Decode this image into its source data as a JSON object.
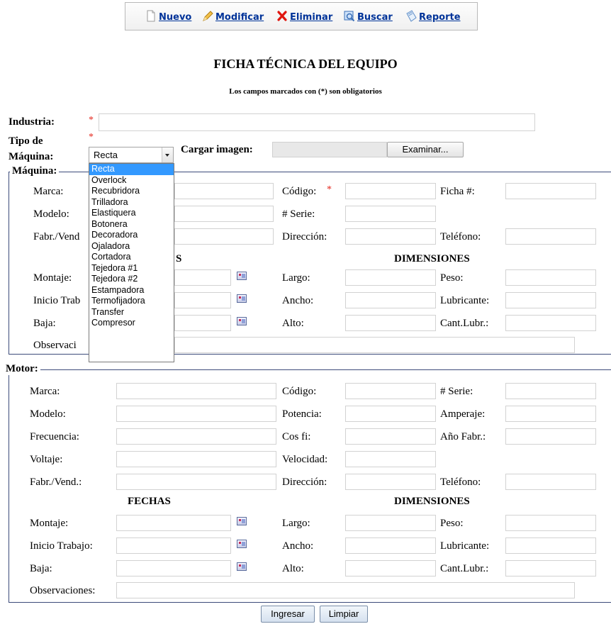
{
  "toolbar": {
    "items": [
      {
        "label": "Nuevo",
        "icon": "new-page-icon"
      },
      {
        "label": "Modificar",
        "icon": "pencil-icon"
      },
      {
        "label": "Eliminar",
        "icon": "delete-x-icon"
      },
      {
        "label": "Buscar",
        "icon": "search-icon"
      },
      {
        "label": "Reporte",
        "icon": "report-icon"
      }
    ]
  },
  "page": {
    "title": "FICHA TÉCNICA DEL EQUIPO",
    "subtitle": "Los campos marcados con (*) son obligatorios"
  },
  "header": {
    "industria_label": "Industria:",
    "tipo_label_1": "Tipo de",
    "tipo_label_2": "Máquina:",
    "required_mark": "*",
    "tipo_selected": "Recta",
    "cargar_label": "Cargar imagen:",
    "examinar_label": "Examinar..."
  },
  "dropdown": {
    "options": [
      "Recta",
      "Overlock",
      "Recubridora",
      "Trilladora",
      "Elastiquera",
      "Botonera",
      "Decoradora",
      "Ojaladora",
      "Cortadora",
      "Tejedora #1",
      "Tejedora #2",
      "Estampadora",
      "Termofijadora",
      "Transfer",
      "Compresor"
    ]
  },
  "maquina": {
    "legend": "Máquina:",
    "marca": "Marca:",
    "codigo": "Código:",
    "ficha": "Ficha #:",
    "modelo": "Modelo:",
    "serie": "# Serie:",
    "fabr": "Fabr./Vend",
    "direccion": "Dirección:",
    "telefono": "Teléfono:",
    "fechas_tail": "S",
    "dimensiones": "DIMENSIONES",
    "montaje": "Montaje:",
    "largo": "Largo:",
    "peso": "Peso:",
    "inicio": "Inicio Trab",
    "ancho": "Ancho:",
    "lubricante": "Lubricante:",
    "baja": "Baja:",
    "alto": "Alto:",
    "cant": "Cant.Lubr.:",
    "observ": "Observaci"
  },
  "motor": {
    "legend": "Motor:",
    "marca": "Marca:",
    "codigo": "Código:",
    "serie": "# Serie:",
    "modelo": "Modelo:",
    "potencia": "Potencia:",
    "amperaje": "Amperaje:",
    "frecuencia": "Frecuencia:",
    "cosfi": "Cos fi:",
    "anio": "Año Fabr.:",
    "voltaje": "Voltaje:",
    "velocidad": "Velocidad:",
    "fabr": "Fabr./Vend.:",
    "direccion": "Dirección:",
    "telefono": "Teléfono:",
    "fechas": "FECHAS",
    "dimensiones": "DIMENSIONES",
    "montaje": "Montaje:",
    "largo": "Largo:",
    "peso": "Peso:",
    "inicio": "Inicio Trabajo:",
    "ancho": "Ancho:",
    "lubricante": "Lubricante:",
    "baja": "Baja:",
    "alto": "Alto:",
    "cant": "Cant.Lubr.:",
    "observ": "Observaciones:"
  },
  "actions": {
    "ingresar": "Ingresar",
    "limpiar": "Limpiar"
  }
}
